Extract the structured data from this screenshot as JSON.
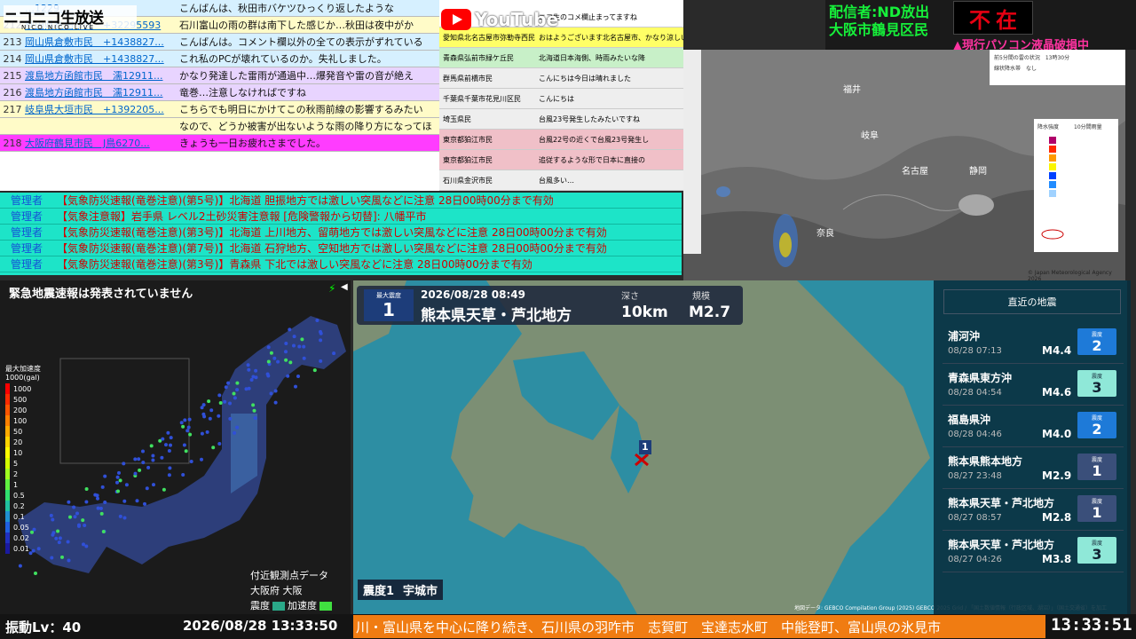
{
  "niconico": {
    "logo": "ニコニコ生放送",
    "sub": "NICO NICO LIVE",
    "rows": [
      {
        "num": "",
        "name": "…1229…",
        "text": "こんばんは、秋田市バケツひっくり返したような",
        "bg": "#d6f0ff"
      },
      {
        "num": "212",
        "name": "秋田県秋田市民　+32295593",
        "text": "石川富山の雨の群は南下した感じか…秋田は夜中がか",
        "bg": "#fffbc8"
      },
      {
        "num": "213",
        "name": "岡山県倉敷市民　+1438827...",
        "text": "こんばんは。コメント欄以外の全ての表示がずれている",
        "bg": "#d6f0ff"
      },
      {
        "num": "214",
        "name": "岡山県倉敷市民　+1438827...",
        "text": "これ私のPCが壊れているのか。失礼しました。",
        "bg": "#d6f0ff"
      },
      {
        "num": "215",
        "name": "渡島地方函館市民　濡12911...",
        "text": "かなり発達した雷雨が通過中…爆発音や雷の音が絶え",
        "bg": "#e8d4ff"
      },
      {
        "num": "216",
        "name": "渡島地方函館市民　濡12911...",
        "text": "竜巻…注意しなければですね",
        "bg": "#e8d4ff"
      },
      {
        "num": "217",
        "name": "岐阜県大垣市民　+1392205...",
        "text": "こちらでも明日にかけてこの秋雨前線の影響するみたい",
        "bg": "#fffbc8"
      },
      {
        "num": "",
        "name": "",
        "text": "なので、どうか被害が出ないような雨の降り方になってほ",
        "bg": "#fffbc8"
      },
      {
        "num": "218",
        "name": "大阪府鶴見市民　J鳥6270...",
        "text": "きょうも一日お疲れさまでした。",
        "bg": "#ff3cff"
      }
    ]
  },
  "youtube": {
    "logo": "YouTube",
    "rows": [
      {
        "name": "",
        "text": "ニコ生のコメ欄止まってますね",
        "bg": "#fff"
      },
      {
        "name": "愛知県北名古屋市弥勒寺西民",
        "text": "おはようございます北名古屋市、かなり涼しいです",
        "bg": "#ffff66"
      },
      {
        "name": "青森県弘前市緑ケ丘民",
        "text": "北海道日本海側、時雨みたいな降",
        "bg": "#c8f0c8"
      },
      {
        "name": "群馬県前橋市民",
        "text": "こんにちは今日は晴れました",
        "bg": "#eee"
      },
      {
        "name": "千葉県千葉市花見川区民",
        "text": "こんにちは",
        "bg": "#eee"
      },
      {
        "name": "埼玉県民",
        "text": "台風23号発生したみたいですね",
        "bg": "#eee"
      },
      {
        "name": "東京都狛江市民",
        "text": "台風22号の近くで台風23号発生し",
        "bg": "#f0c0c8"
      },
      {
        "name": "東京都狛江市民",
        "text": "追従するような形で日本に直接の",
        "bg": "#f0c0c8"
      },
      {
        "name": "石川県金沢市民",
        "text": "台風多い…",
        "bg": "#eee"
      }
    ]
  },
  "status": {
    "line1": "配信者:ND放出",
    "line2": "大阪市鶴見区民",
    "box_left": "不",
    "box_right": "在",
    "line3": "▲現行パソコン液晶破損中"
  },
  "radar": {
    "legend_title": "降水強度",
    "legend_sub": "10分間雨量",
    "info1": "前5分間の雷の状況　13時30分",
    "info2": "線状降水帯　なし",
    "credit": "© Japan Meteorological Agency 2026",
    "cities": [
      "福井",
      "岐阜",
      "名古屋",
      "静岡",
      "奈良"
    ]
  },
  "alerts": [
    {
      "who": "管理者",
      "text": "【気象防災速報(竜巻注意)(第5号)】北海道 胆振地方では激しい突風などに注意 28日00時00分まで有効"
    },
    {
      "who": "管理者",
      "text": "【気象注意報】岩手県 レベル2土砂災害注意報 [危険警報から切替]: 八幡平市"
    },
    {
      "who": "管理者",
      "text": "【気象防災速報(竜巻注意)(第3号)】北海道 上川地方、留萌地方では激しい突風などに注意 28日00時00分まで有効"
    },
    {
      "who": "管理者",
      "text": "【気象防災速報(竜巻注意)(第7号)】北海道 石狩地方、空知地方では激しい突風などに注意 28日00時00分まで有効"
    },
    {
      "who": "管理者",
      "text": "【気象防災速報(竜巻注意)(第3号)】青森県 下北では激しい突風などに注意 28日00時00分まで有効"
    }
  ],
  "jpmap": {
    "title": "緊急地震速報は発表されていません",
    "legend_title": "最大加速度",
    "legend_unit": "1000(gal)",
    "legend_values": [
      "1000",
      "500",
      "200",
      "100",
      "50",
      "20",
      "10",
      "5",
      "2",
      "1",
      "0.5",
      "0.2",
      "0.1",
      "0.05",
      "0.02",
      "0.01"
    ],
    "legend_colors": [
      "#ff0000",
      "#ff2a00",
      "#ff5500",
      "#ff8000",
      "#ffaa00",
      "#ffd400",
      "#ffff00",
      "#d4ff00",
      "#a0ff20",
      "#60f040",
      "#30e070",
      "#20c0a0",
      "#2090d0",
      "#2060e0",
      "#2030c0",
      "#1a1aa0"
    ],
    "near_title": "付近観測点データ",
    "near_station": "大阪府 大阪",
    "near_int_label": "震度",
    "near_acc_label": "加速度",
    "vib_label": "振動Lv：40",
    "datetime": "2026/08/28 13:33:50"
  },
  "eq": {
    "int_label": "最大震度",
    "int_value": "1",
    "time": "2026/08/28 08:49",
    "place": "熊本県天草・芦北地方",
    "depth_label": "深さ",
    "depth_value": "10km",
    "mag_label": "規模",
    "mag_value": "M2.7",
    "station_int": "震度1",
    "station_name": "宇城市",
    "credit": "地図データ: GEBCO Compilation Group (2025) GEBCO 2025 Grid / 「国土数値情報（行政区域、湖沼）」（国土交通省）を加工",
    "marker_label": "1"
  },
  "recent": {
    "title": "直近の地震",
    "items": [
      {
        "name": "浦河沖",
        "time": "08/28 07:13",
        "mag": "M4.4",
        "int": "2",
        "color": "#1e7ad8"
      },
      {
        "name": "青森県東方沖",
        "time": "08/28 04:54",
        "mag": "M4.6",
        "int": "3",
        "color": "#8fe8d8"
      },
      {
        "name": "福島県沖",
        "time": "08/28 04:46",
        "mag": "M4.0",
        "int": "2",
        "color": "#1e7ad8"
      },
      {
        "name": "熊本県熊本地方",
        "time": "08/27 23:48",
        "mag": "M2.9",
        "int": "1",
        "color": "#3a4f7a"
      },
      {
        "name": "熊本県天草・芦北地方",
        "time": "08/27 08:57",
        "mag": "M2.8",
        "int": "1",
        "color": "#3a4f7a"
      },
      {
        "name": "熊本県天草・芦北地方",
        "time": "08/27 04:26",
        "mag": "M3.8",
        "int": "3",
        "color": "#8fe8d8"
      }
    ]
  },
  "ticker": "川・富山県を中心に降り続き、石川県の羽咋市　志賀町　宝達志水町　中能登町、富山県の氷見市",
  "clock": "13:33:51"
}
